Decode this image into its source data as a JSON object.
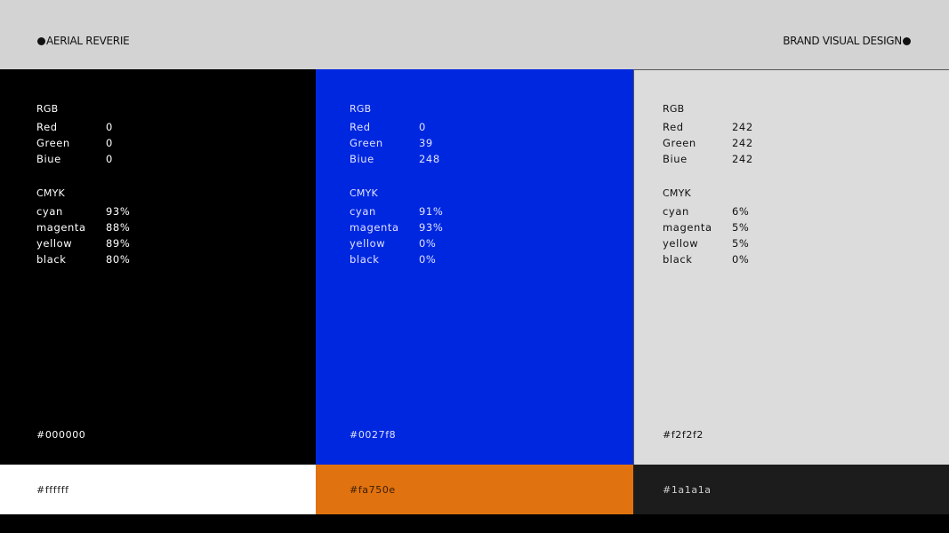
{
  "header": {
    "left_label": "AERIAL REVERIE",
    "right_label": "BRAND VISUAL DESIGN"
  },
  "panels": [
    {
      "rgb_title": "RGB",
      "rgb": [
        {
          "label": "Red",
          "value": "0"
        },
        {
          "label": "Green",
          "value": "0"
        },
        {
          "label": "Biue",
          "value": "0"
        }
      ],
      "cmyk_title": "CMYK",
      "cmyk": [
        {
          "label": "cyan",
          "value": "93%"
        },
        {
          "label": "magenta",
          "value": "88%"
        },
        {
          "label": "yellow",
          "value": "89%"
        },
        {
          "label": "black",
          "value": "80%"
        }
      ],
      "hex": "#000000",
      "color": "#000000"
    },
    {
      "rgb_title": "RGB",
      "rgb": [
        {
          "label": "Red",
          "value": "0"
        },
        {
          "label": "Green",
          "value": "39"
        },
        {
          "label": "Biue",
          "value": "248"
        }
      ],
      "cmyk_title": "CMYK",
      "cmyk": [
        {
          "label": "cyan",
          "value": "91%"
        },
        {
          "label": "magenta",
          "value": "93%"
        },
        {
          "label": "yellow",
          "value": "0%"
        },
        {
          "label": "black",
          "value": "0%"
        }
      ],
      "hex": "#0027f8",
      "color": "#0027f8"
    },
    {
      "rgb_title": "RGB",
      "rgb": [
        {
          "label": "Red",
          "value": "242"
        },
        {
          "label": "Green",
          "value": "242"
        },
        {
          "label": "Biue",
          "value": "242"
        }
      ],
      "cmyk_title": "CMYK",
      "cmyk": [
        {
          "label": "cyan",
          "value": "6%"
        },
        {
          "label": "magenta",
          "value": "5%"
        },
        {
          "label": "yellow",
          "value": "5%"
        },
        {
          "label": "black",
          "value": "0%"
        }
      ],
      "hex": "#f2f2f2",
      "color": "#f2f2f2"
    }
  ],
  "strips": [
    {
      "hex": "#ffffff",
      "color": "#ffffff"
    },
    {
      "hex": "#fa750e",
      "color": "#fa750e"
    },
    {
      "hex": "#1a1a1a",
      "color": "#1a1a1a"
    }
  ]
}
